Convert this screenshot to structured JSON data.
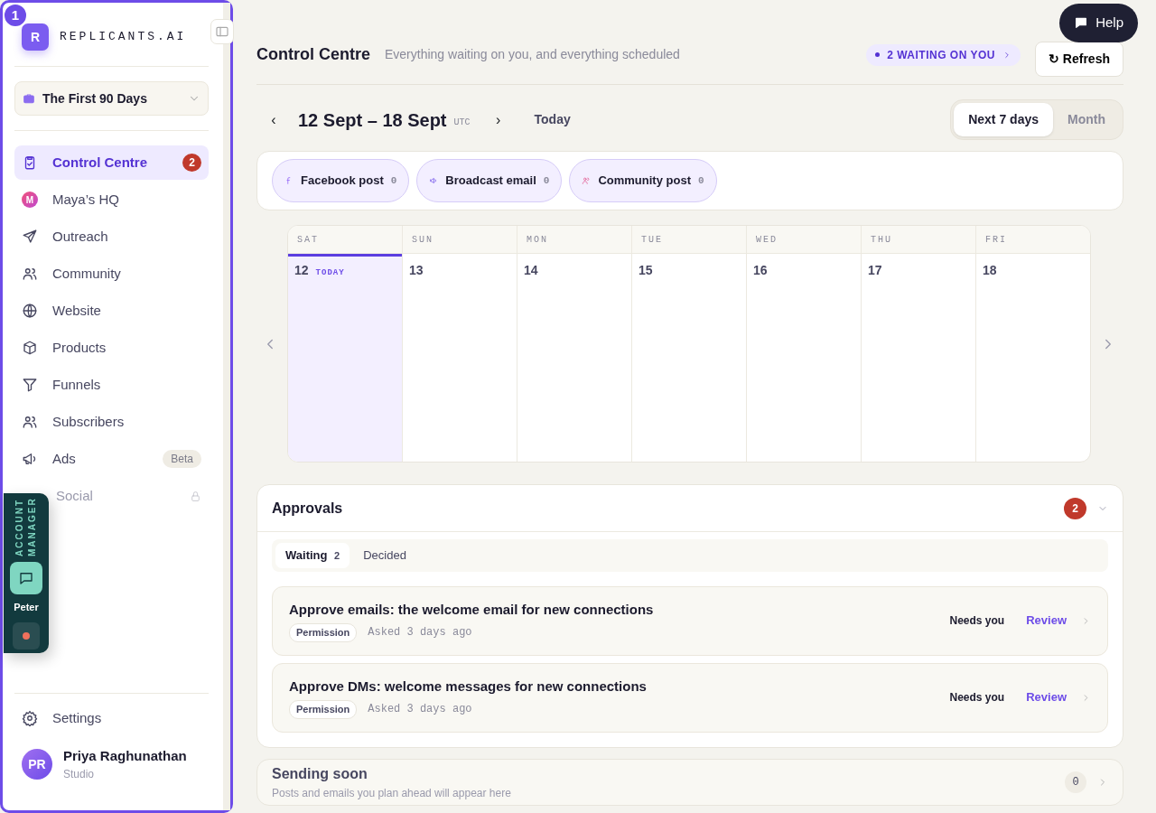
{
  "annotation": {
    "label": "1"
  },
  "brand": {
    "logo_letter": "R",
    "name": "REPLICANTS.AI"
  },
  "workspace": {
    "label": "The First 90 Days"
  },
  "nav": [
    {
      "label": "Control Centre",
      "selected": true,
      "kind": "count",
      "badge": "2"
    },
    {
      "label": "Maya’s HQ",
      "selected": false,
      "kind": "plain",
      "avatar_letter": "M"
    },
    {
      "label": "Outreach",
      "selected": false,
      "kind": "plain"
    },
    {
      "label": "Community",
      "selected": false,
      "kind": "plain"
    },
    {
      "label": "Website",
      "selected": false,
      "kind": "plain"
    },
    {
      "label": "Products",
      "selected": false,
      "kind": "plain"
    },
    {
      "label": "Funnels",
      "selected": false,
      "kind": "plain"
    },
    {
      "label": "Subscribers",
      "selected": false,
      "kind": "plain"
    },
    {
      "label": "Ads",
      "selected": false,
      "kind": "tag",
      "badge": "Beta"
    },
    {
      "label": "Social",
      "selected": false,
      "kind": "locked"
    }
  ],
  "account_manager": {
    "title": "ACCOUNT MANAGER",
    "name": "Peter"
  },
  "settings": {
    "label": "Settings"
  },
  "user": {
    "initials": "PR",
    "name": "Priya Raghunathan",
    "plan": "Studio"
  },
  "header": {
    "title": "Control Centre",
    "subtitle": "Everything waiting on you, and everything scheduled",
    "waiting": "2 WAITING ON YOU",
    "refresh": "↻ Refresh"
  },
  "help": {
    "label": "Help"
  },
  "range": {
    "prev": "‹",
    "label": "12 Sept – 18 Sept",
    "zone": "UTC",
    "next": "›",
    "today": "Today"
  },
  "views": [
    {
      "label": "Next 7 days",
      "selected": true
    },
    {
      "label": "Month",
      "selected": false
    }
  ],
  "channels": [
    {
      "label": "Facebook post",
      "count": "0"
    },
    {
      "label": "Broadcast email",
      "count": "0"
    },
    {
      "label": "Community post",
      "count": "0"
    }
  ],
  "calendar": {
    "days": [
      {
        "dow": "SAT",
        "date": "12",
        "today": true,
        "today_label": "TODAY"
      },
      {
        "dow": "SUN",
        "date": "13",
        "today": false
      },
      {
        "dow": "MON",
        "date": "14",
        "today": false
      },
      {
        "dow": "TUE",
        "date": "15",
        "today": false
      },
      {
        "dow": "WED",
        "date": "16",
        "today": false
      },
      {
        "dow": "THU",
        "date": "17",
        "today": false
      },
      {
        "dow": "FRI",
        "date": "18",
        "today": false
      }
    ]
  },
  "approvals": {
    "title": "Approvals",
    "count": "2",
    "expanded": true,
    "tabs": [
      {
        "label": "Waiting",
        "count": "2",
        "selected": true
      },
      {
        "label": "Decided",
        "selected": false
      }
    ],
    "items": [
      {
        "title": "Approve emails: the welcome email for new connections",
        "tag": "Permission",
        "asked": "Asked 3 days ago",
        "status": "Needs you",
        "action": "Review"
      },
      {
        "title": "Approve DMs: welcome messages for new connections",
        "tag": "Permission",
        "asked": "Asked 3 days ago",
        "status": "Needs you",
        "action": "Review"
      }
    ]
  },
  "sending_soon": {
    "title": "Sending soon",
    "subtitle": "Posts and emails you plan ahead will appear here",
    "count": "0"
  }
}
